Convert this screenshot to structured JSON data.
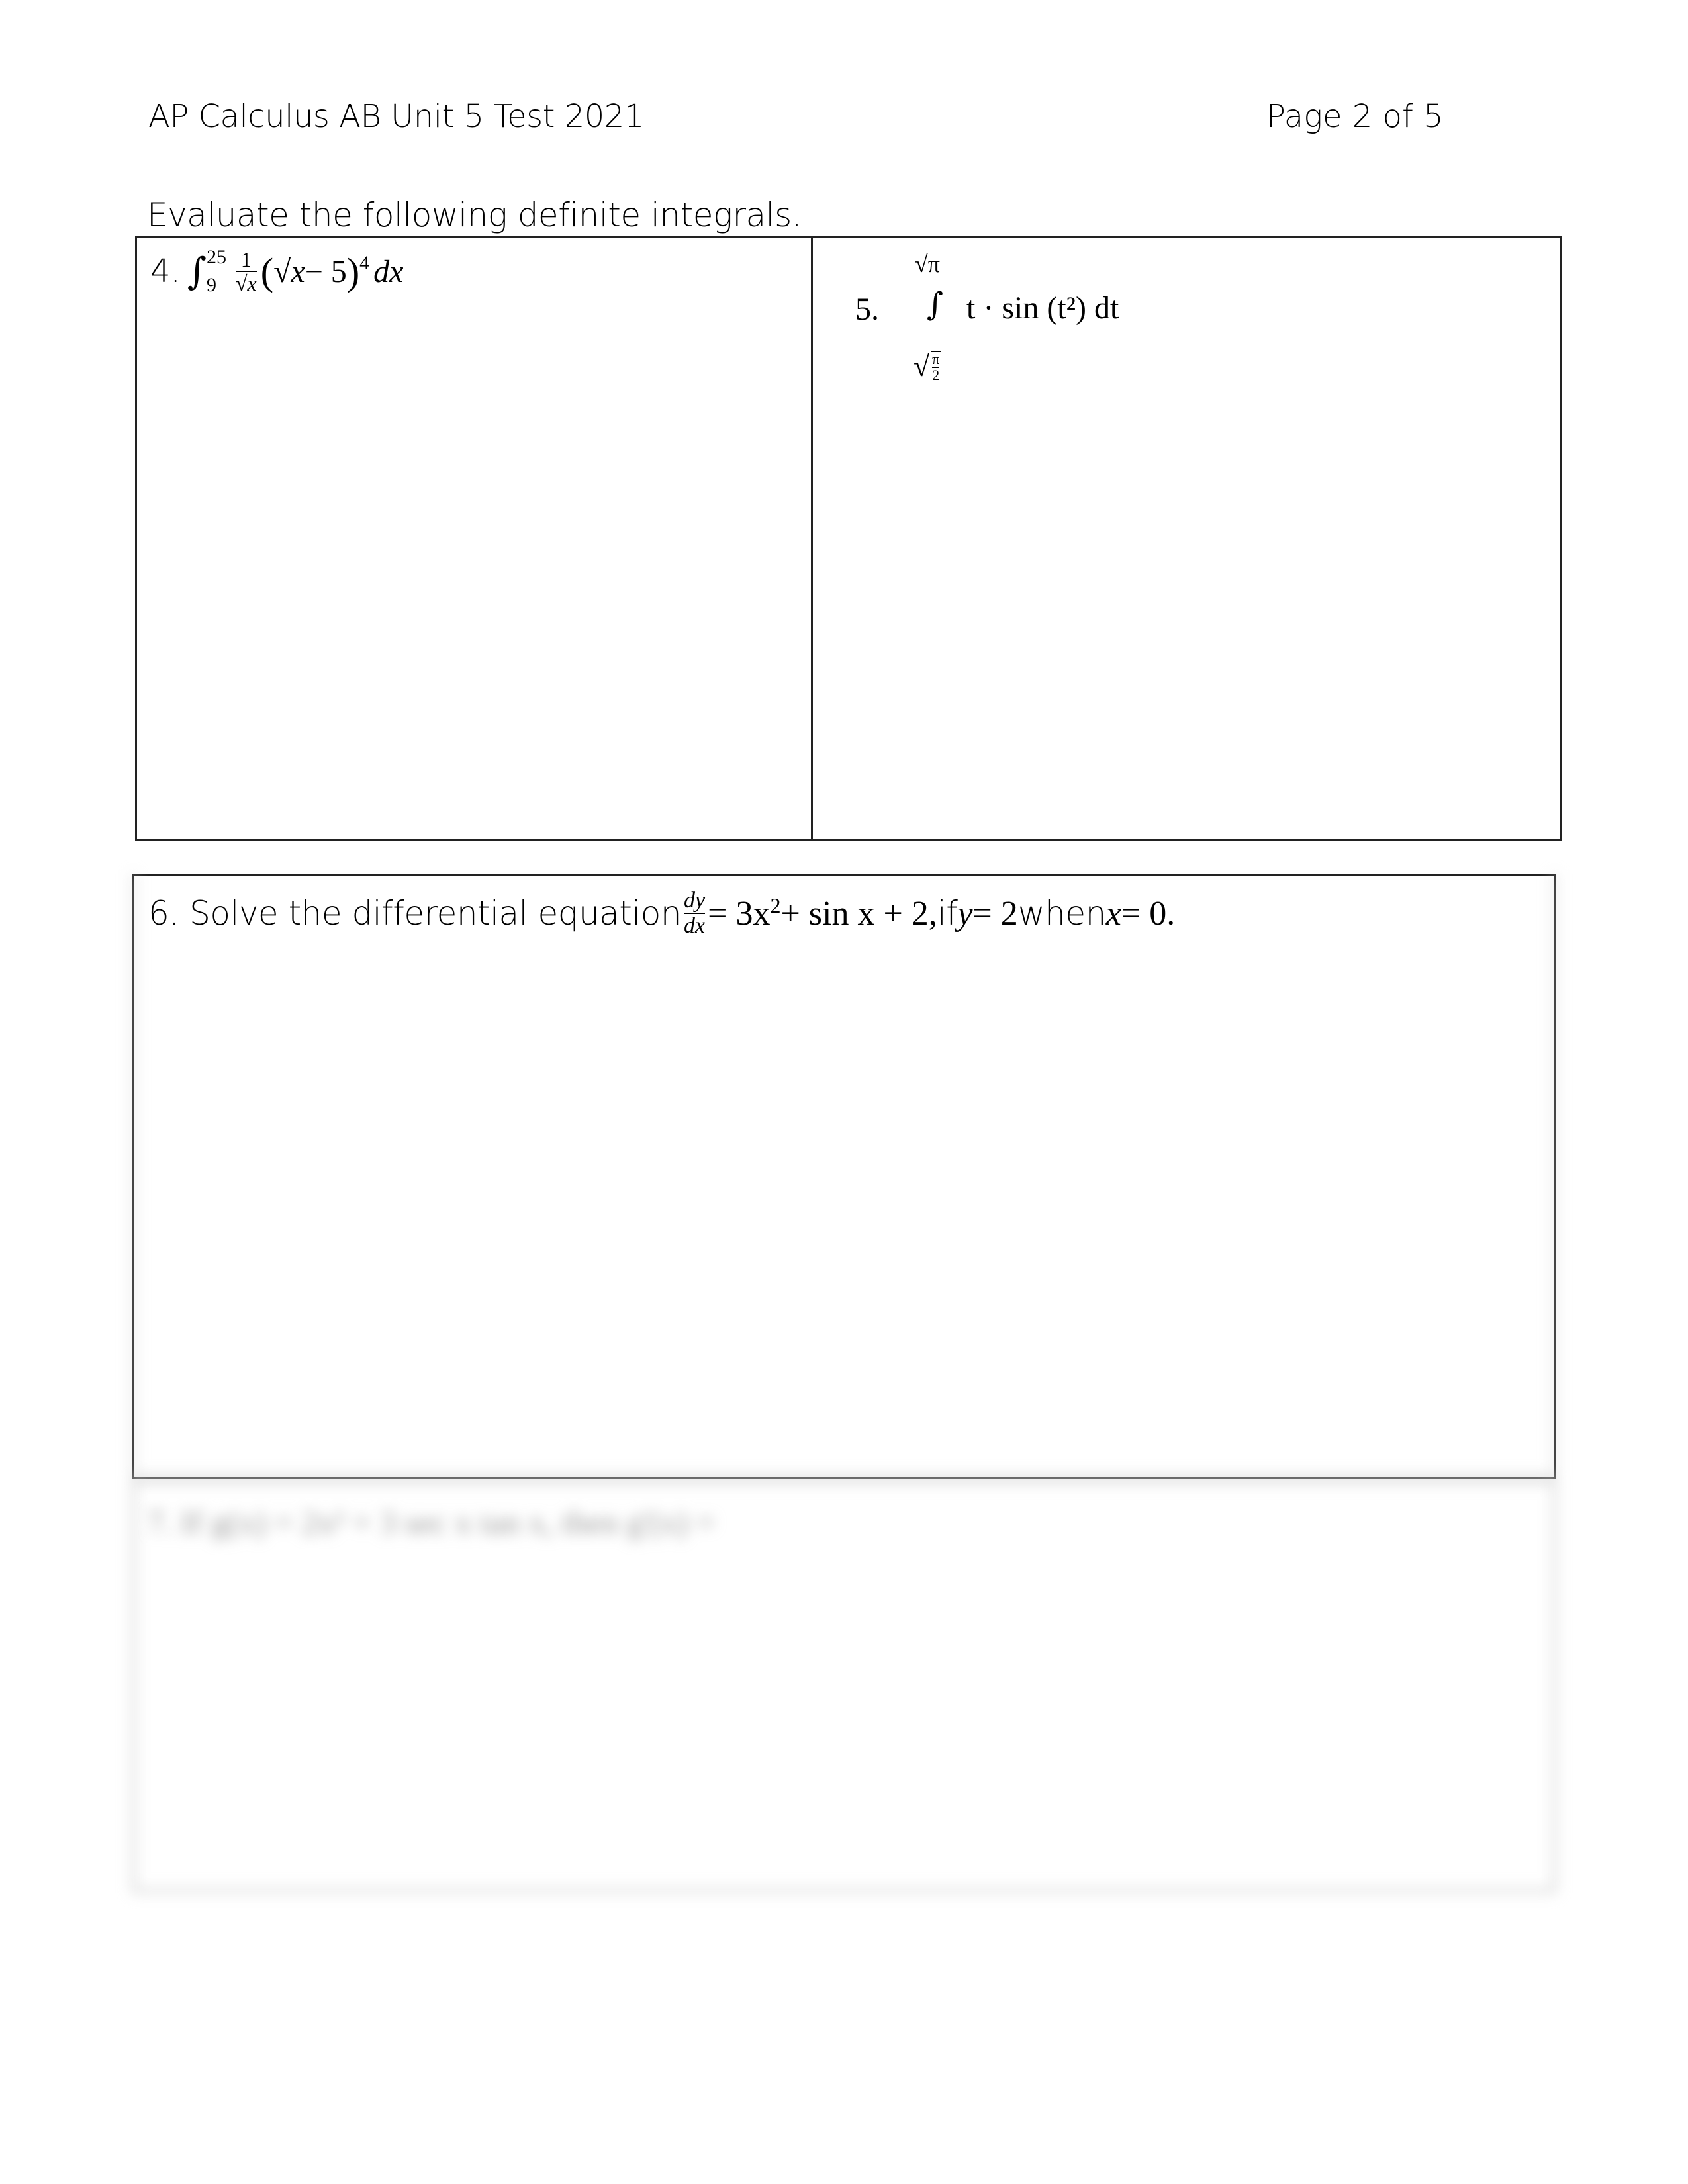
{
  "header": {
    "title": "AP Calculus AB Unit 5 Test 2021",
    "page_indicator": "Page 2 of 5"
  },
  "instructions": "Evaluate the following definite integrals.",
  "questions": {
    "q4": {
      "number": "4.",
      "integral_sign": "∫",
      "upper_limit": "25",
      "lower_limit": "9",
      "frac_numerator": "1",
      "frac_denominator": "√x",
      "open_paren": "(",
      "radical": "√x",
      "minus_five": " − 5",
      "close_paren": ")",
      "exponent": "4",
      "differential": "dx"
    },
    "q5": {
      "number": "5.",
      "upper_limit": "√π",
      "integral_sign": "∫",
      "integrand": "t · sin (t²) dt",
      "lower_limit_radical": "√",
      "lower_limit_numerator": "π",
      "lower_limit_denominator": "2"
    },
    "q6": {
      "prefix": "6. Solve the differential equation ",
      "dy": "dy",
      "dx": "dx",
      "rhs": " = 3x",
      "rhs_exp": "2",
      "rhs_rest": " + sin x + 2,",
      "if_text": " if ",
      "y_var": "y",
      "eq2": " = 2 ",
      "when_text": "when ",
      "x_var": "x",
      "eq0": " = 0."
    },
    "q7": {
      "blurred_text": "7.  If g(x) = 2x² + 3 sec x tan x, then g'(x) ="
    }
  }
}
